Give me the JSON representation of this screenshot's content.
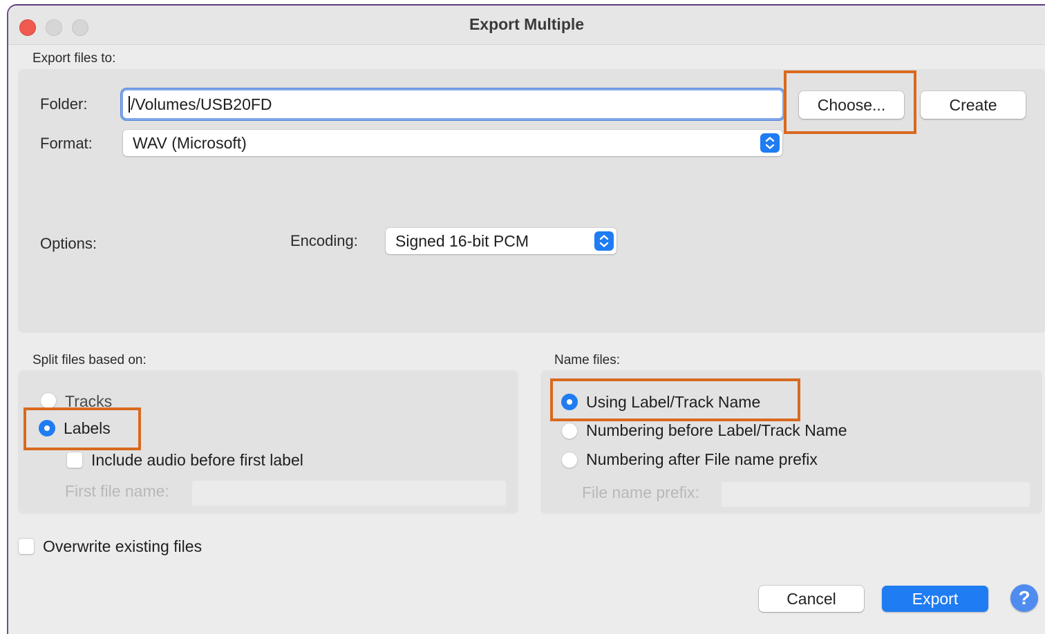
{
  "window": {
    "title": "Export Multiple"
  },
  "export_to": {
    "group_label": "Export files to:",
    "folder_label": "Folder:",
    "folder_value": "/Volumes/USB20FD",
    "choose_label": "Choose...",
    "create_label": "Create",
    "format_label": "Format:",
    "format_value": "WAV (Microsoft)"
  },
  "options": {
    "label": "Options:",
    "encoding_label": "Encoding:",
    "encoding_value": "Signed 16-bit PCM"
  },
  "split": {
    "group_label": "Split files based on:",
    "tracks_label": "Tracks",
    "labels_label": "Labels",
    "selected": "Labels",
    "include_audio_label": "Include audio before first label",
    "include_audio_checked": false,
    "first_file_name_label": "First file name:",
    "first_file_name_value": ""
  },
  "name_files": {
    "group_label": "Name files:",
    "using_label": "Using Label/Track Name",
    "numbering_before_label": "Numbering before Label/Track Name",
    "numbering_after_label": "Numbering after File name prefix",
    "selected": "Using Label/Track Name",
    "prefix_label": "File name prefix:",
    "prefix_value": ""
  },
  "overwrite": {
    "label": "Overwrite existing files",
    "checked": false
  },
  "footer": {
    "cancel_label": "Cancel",
    "export_label": "Export",
    "help_symbol": "?"
  },
  "colors": {
    "accent": "#1f7cf2",
    "highlight": "#d9691f",
    "close": "#f05a50"
  },
  "icons": [
    "close-button",
    "minimize-button",
    "zoom-button",
    "stepper-chevron-icon",
    "help-icon"
  ]
}
